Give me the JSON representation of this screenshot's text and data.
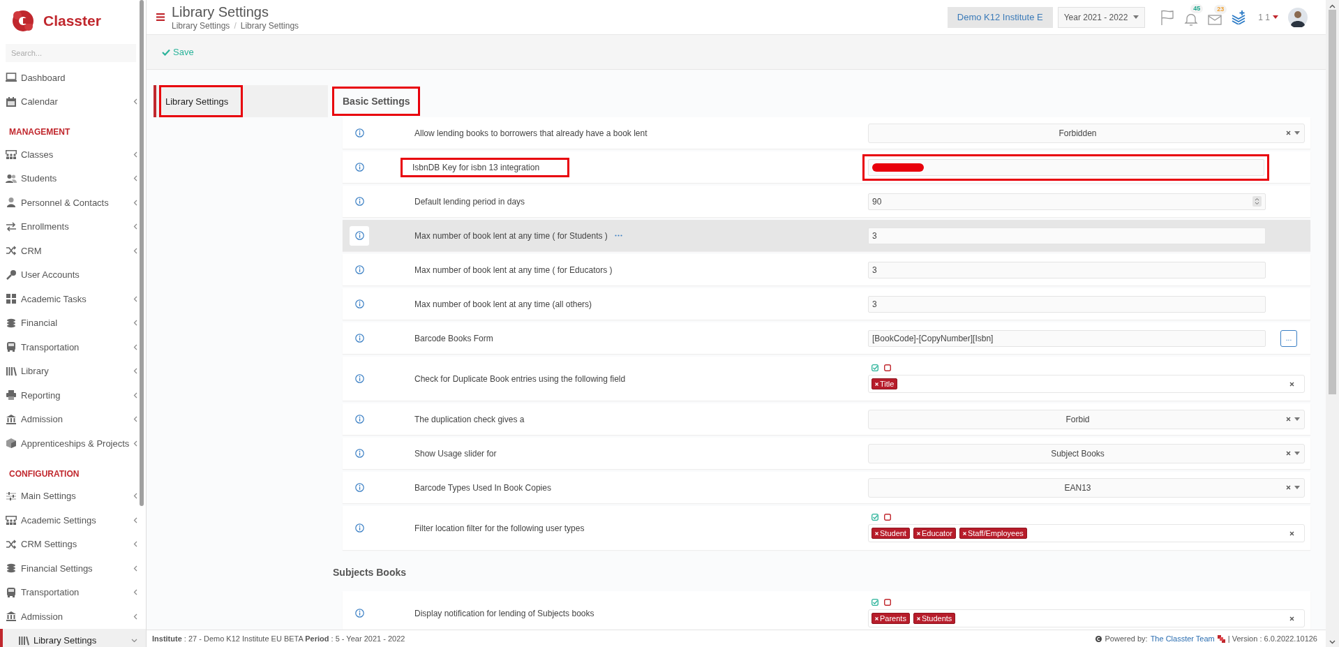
{
  "brand": {
    "name": "Classter"
  },
  "sidebar": {
    "search": {
      "placeholder": "Search..."
    },
    "sections": [
      {
        "items": [
          {
            "label": "Dashboard",
            "expandable": false,
            "expanded": false,
            "selected": false
          },
          {
            "label": "Calendar",
            "expandable": true,
            "expanded": false,
            "selected": false
          }
        ]
      },
      {
        "heading": "MANAGEMENT",
        "items": [
          {
            "label": "Classes",
            "expandable": true,
            "expanded": false,
            "selected": false
          },
          {
            "label": "Students",
            "expandable": true,
            "expanded": false,
            "selected": false
          },
          {
            "label": "Personnel & Contacts",
            "expandable": true,
            "expanded": false,
            "selected": false
          },
          {
            "label": "Enrollments",
            "expandable": true,
            "expanded": false,
            "selected": false
          },
          {
            "label": "CRM",
            "expandable": true,
            "expanded": false,
            "selected": false
          },
          {
            "label": "User Accounts",
            "expandable": false,
            "expanded": false,
            "selected": false
          },
          {
            "label": "Academic Tasks",
            "expandable": true,
            "expanded": false,
            "selected": false
          },
          {
            "label": "Financial",
            "expandable": true,
            "expanded": false,
            "selected": false
          },
          {
            "label": "Transportation",
            "expandable": true,
            "expanded": false,
            "selected": false
          },
          {
            "label": "Library",
            "expandable": true,
            "expanded": false,
            "selected": false
          },
          {
            "label": "Reporting",
            "expandable": true,
            "expanded": false,
            "selected": false
          },
          {
            "label": "Admission",
            "expandable": true,
            "expanded": false,
            "selected": false
          },
          {
            "label": "Apprenticeships & Projects",
            "expandable": true,
            "expanded": false,
            "selected": false
          }
        ]
      },
      {
        "heading": "CONFIGURATION",
        "items": [
          {
            "label": "Main Settings",
            "expandable": true,
            "expanded": false,
            "selected": false
          },
          {
            "label": "Academic Settings",
            "expandable": true,
            "expanded": false,
            "selected": false
          },
          {
            "label": "CRM Settings",
            "expandable": true,
            "expanded": false,
            "selected": false
          },
          {
            "label": "Financial Settings",
            "expandable": true,
            "expanded": false,
            "selected": false
          },
          {
            "label": "Transportation",
            "expandable": true,
            "expanded": false,
            "selected": false
          },
          {
            "label": "Admission",
            "expandable": true,
            "expanded": false,
            "selected": false
          },
          {
            "label": "Library Settings",
            "expandable": true,
            "expanded": true,
            "selected": true
          }
        ]
      }
    ]
  },
  "topbar": {
    "title": "Library Settings",
    "breadcrumb": [
      "Library Settings",
      "Library Settings"
    ],
    "breadcrumb_separator": "/",
    "institute": "Demo K12 Institute E",
    "year": "Year 2021 - 2022",
    "notifications": "45",
    "messages": "23",
    "user": "1 1"
  },
  "toolbar": {
    "save": "Save"
  },
  "tabs": [
    {
      "label": "Library Settings",
      "selected": true,
      "highlighted": true
    }
  ],
  "sections": [
    {
      "title": "Basic Settings",
      "highlighted": true,
      "rows": [
        {
          "kind": "select",
          "label": "Allow lending books to borrowers that already have a book lent",
          "value": "Forbidden",
          "hovered": false,
          "highlighted": false
        },
        {
          "kind": "text",
          "label": "IsbnDB Key for isbn 13 integration",
          "redacted": true,
          "hovered": false,
          "highlighted": true
        },
        {
          "kind": "number",
          "label": "Default lending period in days",
          "value": "90",
          "hovered": false,
          "highlighted": false
        },
        {
          "kind": "text",
          "label": "Max number of book lent at any time ( for Students )",
          "value": "3",
          "hovered": true,
          "highlighted": false
        },
        {
          "kind": "text",
          "label": "Max number of book lent at any time ( for Educators )",
          "value": "3",
          "hovered": false,
          "highlighted": false
        },
        {
          "kind": "text",
          "label": "Max number of book lent at any time (all others)",
          "value": "3",
          "hovered": false,
          "highlighted": false
        },
        {
          "kind": "button",
          "label": "Barcode Books Form",
          "value": "[BookCode]-[CopyNumber][Isbn]",
          "button": "...",
          "hovered": false,
          "highlighted": false
        },
        {
          "kind": "tags",
          "label": "Check for Duplicate Book entries using the following field",
          "tags": [
            "Title"
          ],
          "hovered": false,
          "highlighted": false
        },
        {
          "kind": "select",
          "label": "The duplication check gives a",
          "value": "Forbid",
          "hovered": false,
          "highlighted": false
        },
        {
          "kind": "select",
          "label": "Show Usage slider for",
          "value": "Subject Books",
          "hovered": false,
          "highlighted": false
        },
        {
          "kind": "select",
          "label": "Barcode Types Used In Book Copies",
          "value": "EAN13",
          "hovered": false,
          "highlighted": false
        },
        {
          "kind": "tags",
          "label": "Filter location filter for the following user types",
          "tags": [
            "Student",
            "Educator",
            "Staff/Employees"
          ],
          "hovered": false,
          "highlighted": false
        }
      ]
    },
    {
      "title": "Subjects Books",
      "highlighted": false,
      "rows": [
        {
          "kind": "tags",
          "label": "Display notification for lending of Subjects books",
          "tags": [
            "Parents",
            "Students"
          ],
          "hovered": false,
          "highlighted": false
        }
      ]
    }
  ],
  "footer": {
    "info": "**Institute** : 27 - Demo K12 Institute EU BETA **Period** : 5 - Year 2021 - 2022",
    "powered": "Powered by:",
    "team": "The Classter Team",
    "version": "| Version : 6.0.2022.10126"
  }
}
